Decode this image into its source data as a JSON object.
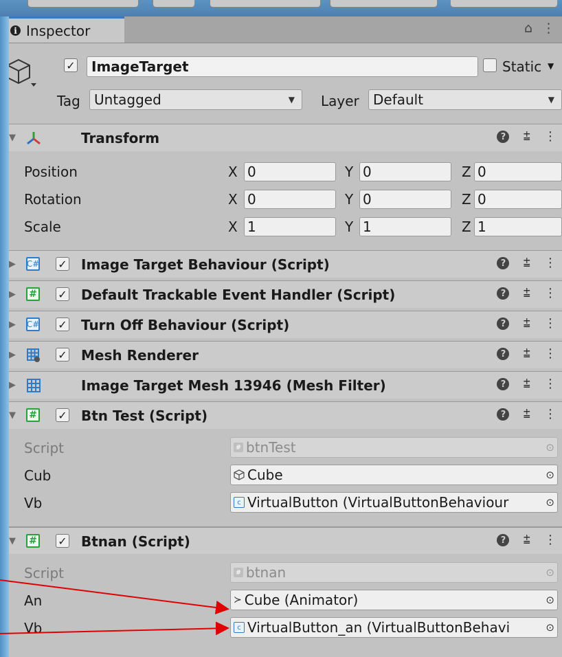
{
  "window": {
    "tab_title": "Inspector"
  },
  "header": {
    "object_name": "ImageTarget",
    "static_label": "Static",
    "tag_label": "Tag",
    "tag_value": "Untagged",
    "layer_label": "Layer",
    "layer_value": "Default"
  },
  "transform": {
    "title": "Transform",
    "rows": [
      {
        "label": "Position",
        "x": "0",
        "y": "0",
        "z": "0"
      },
      {
        "label": "Rotation",
        "x": "0",
        "y": "0",
        "z": "0"
      },
      {
        "label": "Scale",
        "x": "1",
        "y": "1",
        "z": "1"
      }
    ],
    "axis": {
      "x": "X",
      "y": "Y",
      "z": "Z"
    }
  },
  "components": [
    {
      "name": "Image Target Behaviour (Script)",
      "icon": "script-icon",
      "checked": true
    },
    {
      "name": "Default Trackable Event Handler (Script)",
      "icon": "csharp-script-icon",
      "checked": true
    },
    {
      "name": "Turn Off Behaviour (Script)",
      "icon": "script-icon",
      "checked": true
    },
    {
      "name": "Mesh Renderer",
      "icon": "mesh-renderer-icon",
      "checked": true
    },
    {
      "name": "Image Target Mesh 13946 (Mesh Filter)",
      "icon": "mesh-filter-icon",
      "checked": false
    }
  ],
  "btn_test": {
    "title": "Btn Test (Script)",
    "props": [
      {
        "label": "Script",
        "value": "btnTest"
      },
      {
        "label": "Cub",
        "value": "Cube"
      },
      {
        "label": "Vb",
        "value": "VirtualButton (VirtualButtonBehaviour"
      }
    ]
  },
  "btnan": {
    "title": "Btnan (Script)",
    "props": [
      {
        "label": "Script",
        "value": "btnan"
      },
      {
        "label": "An",
        "value": "Cube (Animator)"
      },
      {
        "label": "Vb",
        "value": "VirtualButton_an (VirtualButtonBehavi"
      }
    ]
  },
  "colors": {
    "accent_tab": "#3a79bb",
    "annotation_arrow": "#e00000",
    "script_icon_green": "#27a13a",
    "script_icon_blue": "#2f7bc7"
  }
}
